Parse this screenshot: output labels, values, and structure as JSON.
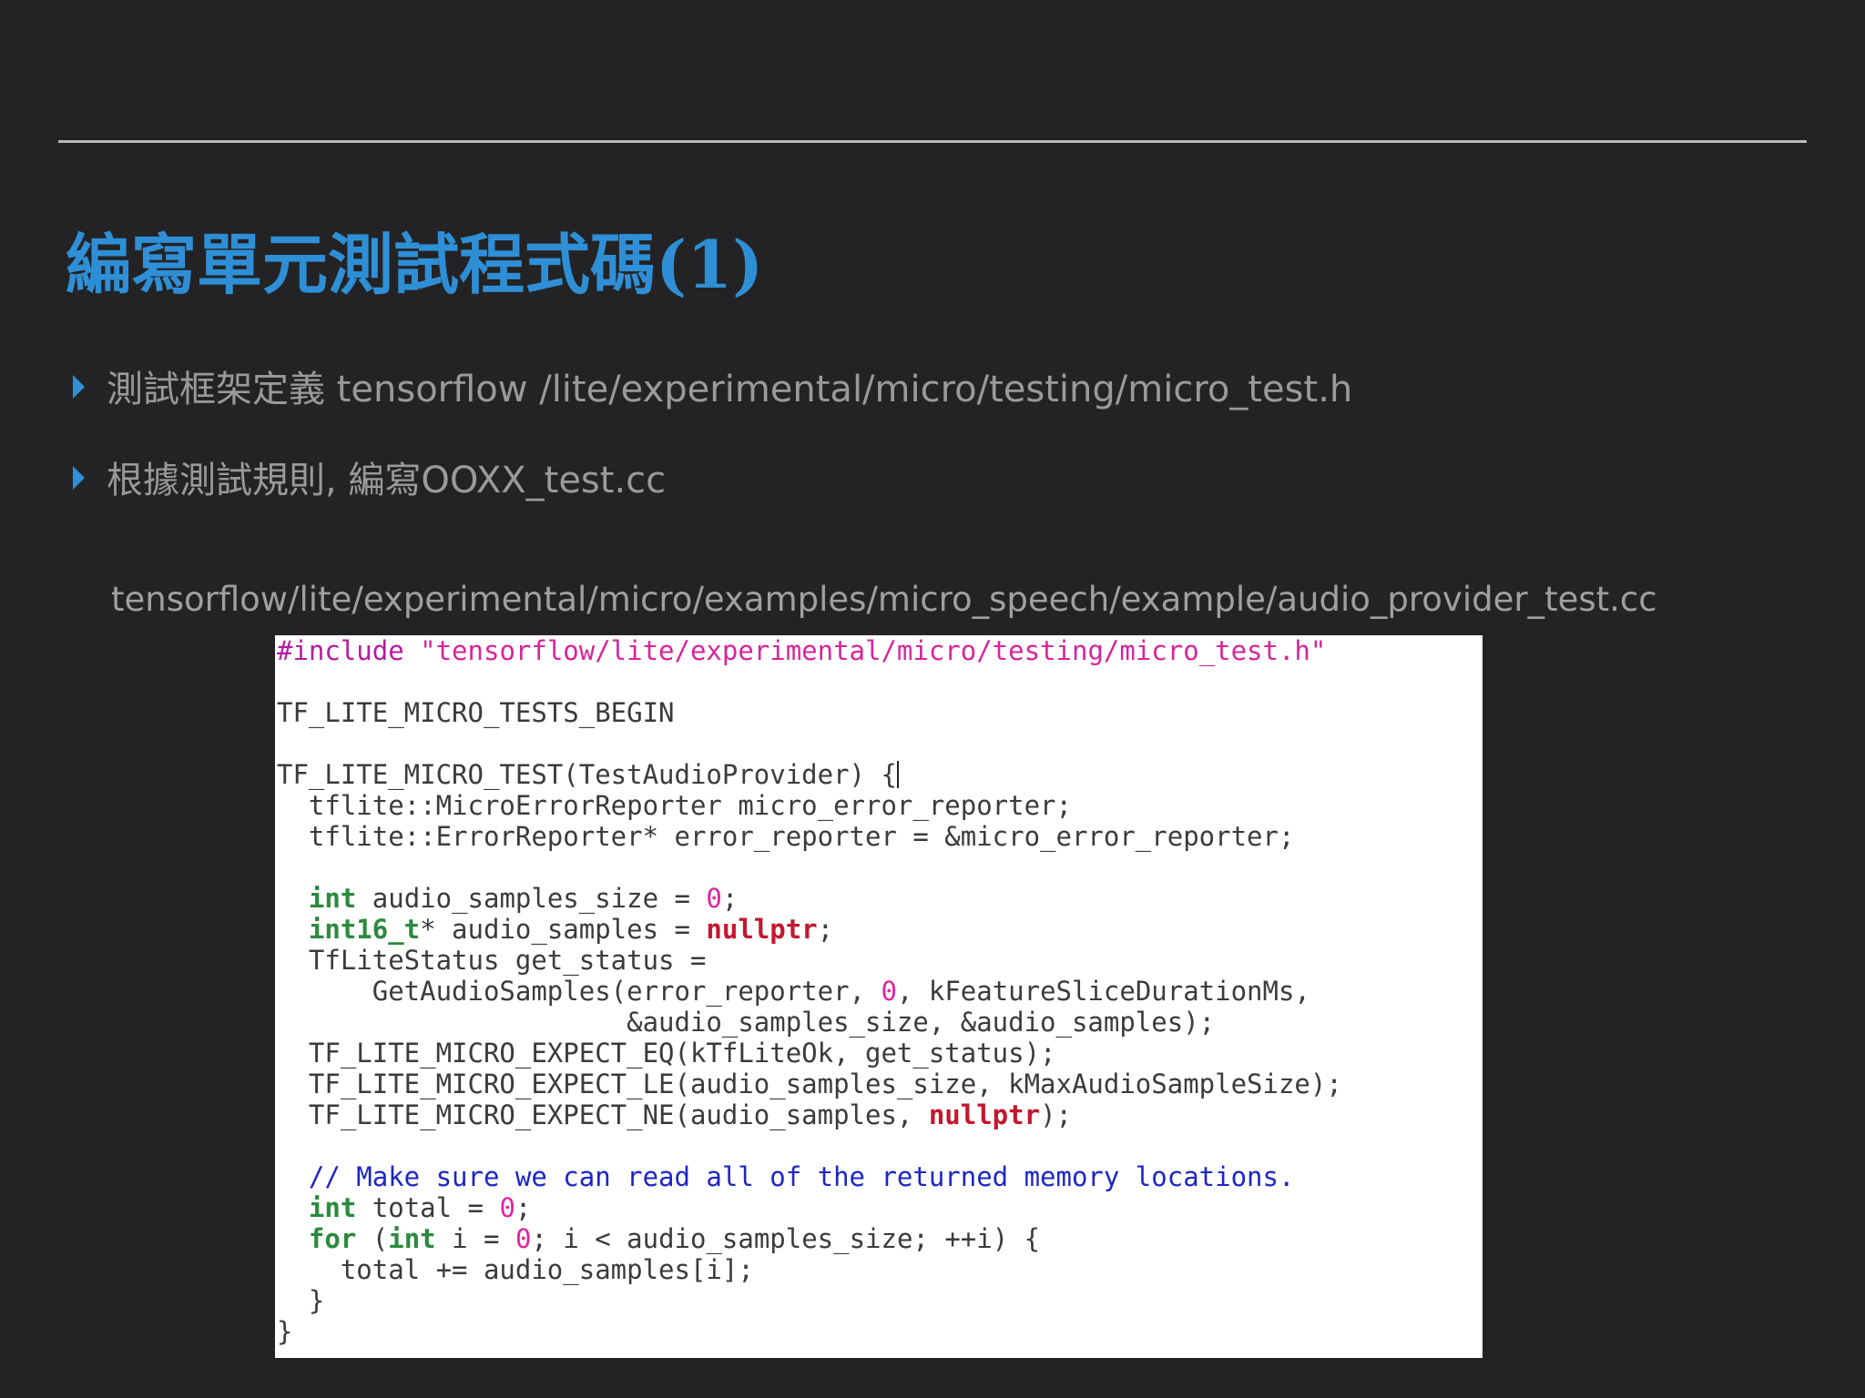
{
  "slide": {
    "title": "編寫單元測試程式碼(1)",
    "bullets": [
      "測試框架定義 tensorflow /lite/experimental/micro/testing/micro_test.h",
      "根據測試規則, 編寫OOXX_test.cc"
    ],
    "caption": "tensorflow/lite/experimental/micro/examples/micro_speech/example/audio_provider_test.cc"
  },
  "colors": {
    "background": "#232325",
    "title": "#2f8fd6",
    "bullet_marker": "#2e90d8",
    "body_text": "#9a9a9a"
  },
  "code": {
    "lines": [
      [
        {
          "t": "#include ",
          "c": "pre"
        },
        {
          "t": "\"tensorflow/lite/experimental/micro/testing/micro_test.h\"",
          "c": "str"
        }
      ],
      [],
      [
        {
          "t": "TF_LITE_MICRO_TESTS_BEGIN"
        }
      ],
      [],
      [
        {
          "t": "TF_LITE_MICRO_TEST(TestAudioProvider) {"
        },
        {
          "t": "",
          "c": "cursor"
        }
      ],
      [
        {
          "t": "  tflite::MicroErrorReporter micro_error_reporter;"
        }
      ],
      [
        {
          "t": "  tflite::ErrorReporter* error_reporter = &micro_error_reporter;"
        }
      ],
      [],
      [
        {
          "t": "  "
        },
        {
          "t": "int",
          "c": "kw"
        },
        {
          "t": " audio_samples_size = "
        },
        {
          "t": "0",
          "c": "num"
        },
        {
          "t": ";"
        }
      ],
      [
        {
          "t": "  "
        },
        {
          "t": "int16_t",
          "c": "kw"
        },
        {
          "t": "* audio_samples = "
        },
        {
          "t": "nullptr",
          "c": "null"
        },
        {
          "t": ";"
        }
      ],
      [
        {
          "t": "  TfLiteStatus get_status ="
        }
      ],
      [
        {
          "t": "      GetAudioSamples(error_reporter, "
        },
        {
          "t": "0",
          "c": "num"
        },
        {
          "t": ", kFeatureSliceDurationMs,"
        }
      ],
      [
        {
          "t": "                      &audio_samples_size, &audio_samples);"
        }
      ],
      [
        {
          "t": "  TF_LITE_MICRO_EXPECT_EQ(kTfLiteOk, get_status);"
        }
      ],
      [
        {
          "t": "  TF_LITE_MICRO_EXPECT_LE(audio_samples_size, kMaxAudioSampleSize);"
        }
      ],
      [
        {
          "t": "  TF_LITE_MICRO_EXPECT_NE(audio_samples, "
        },
        {
          "t": "nullptr",
          "c": "null"
        },
        {
          "t": ");"
        }
      ],
      [],
      [
        {
          "t": "  // Make sure we can read all of the returned memory locations.",
          "c": "com"
        }
      ],
      [
        {
          "t": "  "
        },
        {
          "t": "int",
          "c": "kw"
        },
        {
          "t": " total = "
        },
        {
          "t": "0",
          "c": "num"
        },
        {
          "t": ";"
        }
      ],
      [
        {
          "t": "  "
        },
        {
          "t": "for",
          "c": "kw"
        },
        {
          "t": " ("
        },
        {
          "t": "int",
          "c": "kw"
        },
        {
          "t": " i = "
        },
        {
          "t": "0",
          "c": "num"
        },
        {
          "t": "; i < audio_samples_size; ++i) {"
        }
      ],
      [
        {
          "t": "    total += audio_samples[i];"
        }
      ],
      [
        {
          "t": "  }"
        }
      ],
      [
        {
          "t": "}"
        }
      ]
    ]
  }
}
